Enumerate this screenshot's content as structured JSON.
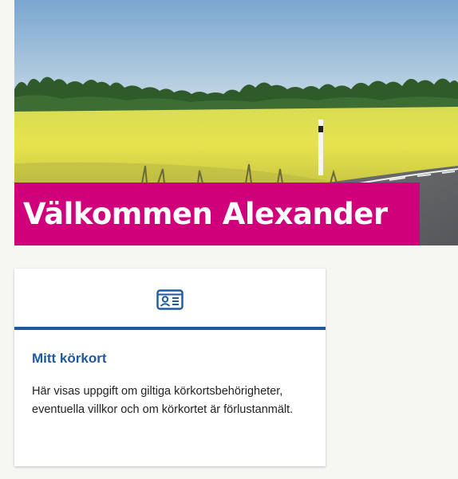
{
  "hero": {
    "welcome_text": "Välkommen Alexander"
  },
  "cards": [
    {
      "icon": "id-card-icon",
      "title": "Mitt körkort",
      "description": "Här visas uppgift om giltiga körkortsbehörigheter, eventuella villkor och om körkortet är förlustanmält."
    }
  ],
  "colors": {
    "accent": "#d0007a",
    "card_title": "#1f5aa0",
    "card_divider": "#1f5aa0",
    "background": "#f6f6f3"
  }
}
